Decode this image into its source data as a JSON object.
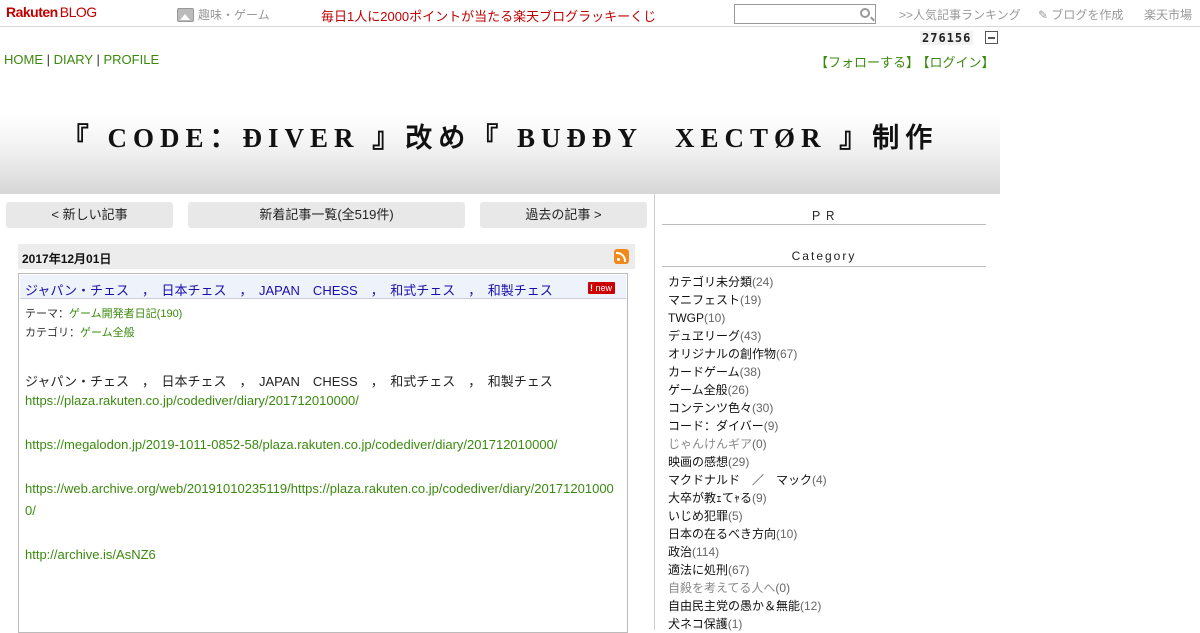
{
  "topbar": {
    "logo_brand": "Rakuten",
    "logo_blog": "BLOG",
    "hobby_label": "趣味・ゲーム",
    "lottery_text": "毎日1人に2000ポイントが当たる楽天ブログラッキーくじ",
    "search_value": "",
    "ranking_label": ">>人気記事ランキング",
    "create_blog_label": "ブログを作成",
    "market_label": "楽天市場"
  },
  "counter": "276156",
  "nav": {
    "home": "HOME",
    "sep1": " | ",
    "diary": "DIARY",
    "sep2": " | ",
    "profile": "PROFILE",
    "follow": "【フォローする】",
    "login": "【ログイン】"
  },
  "blog_title": "『 CODE：ĐIVER 』改め『 BUĐĐY　XECTØR 』制作",
  "pager": {
    "newer": "< 新しい記事",
    "list": "新着記事一覧(全519件)",
    "older": "過去の記事 >"
  },
  "entry": {
    "date": "2017年12月01日",
    "title": "ジャパン・チェス　，　日本チェス　，　JAPAN　CHESS　，　和式チェス　，　和製チェス",
    "new_badge": "new",
    "theme_label": "テーマ：",
    "theme_value": "ゲーム開発者日記(190)",
    "category_label": "カテゴリ：",
    "category_value": "ゲーム全般",
    "body_title": "ジャパン・チェス　，　日本チェス　，　JAPAN　CHESS　，　和式チェス　，　和製チェス",
    "link1": "https://plaza.rakuten.co.jp/codediver/diary/201712010000/",
    "link2": "https://megalodon.jp/2019-1011-0852-58/plaza.rakuten.co.jp/codediver/diary/201712010000/",
    "link3a": "https://web.archive.org/web/20191010235119/https://plaza.rakuten.co.jp/codediver/diary/20171201000",
    "link3b": "0/",
    "link4": "http://archive.is/AsNZ6"
  },
  "sidebar": {
    "pr_heading": "ＰＲ",
    "category_heading": "Category",
    "categories": [
      {
        "name": "カテゴリ未分類",
        "count": "(24)"
      },
      {
        "name": "マニフェスト",
        "count": "(19)"
      },
      {
        "name": "TWGP",
        "count": "(10)"
      },
      {
        "name": "デュヱリーグ",
        "count": "(43)"
      },
      {
        "name": "オリジナルの創作物",
        "count": "(67)"
      },
      {
        "name": "カードゲーム",
        "count": "(38)"
      },
      {
        "name": "ゲーム全般",
        "count": "(26)"
      },
      {
        "name": "コンテンツ色々",
        "count": "(30)"
      },
      {
        "name": "コード：ダイバー",
        "count": "(9)"
      },
      {
        "name": "じゃんけんギア",
        "count": "(0)"
      },
      {
        "name": "映画の感想",
        "count": "(29)"
      },
      {
        "name": "マクドナルド　／　マック",
        "count": "(4)"
      },
      {
        "name": "大卒が教ｪてｬる",
        "count": "(9)"
      },
      {
        "name": "いじめ犯罪",
        "count": "(5)"
      },
      {
        "name": "日本の在るべき方向",
        "count": "(10)"
      },
      {
        "name": "政治",
        "count": "(114)"
      },
      {
        "name": "適法に処刑",
        "count": "(67)"
      },
      {
        "name": "自殺を考えてる人へ",
        "count": "(0)"
      },
      {
        "name": "自由民主党の愚か＆無能",
        "count": "(12)"
      },
      {
        "name": "犬ネコ保護",
        "count": "(1)"
      }
    ]
  }
}
